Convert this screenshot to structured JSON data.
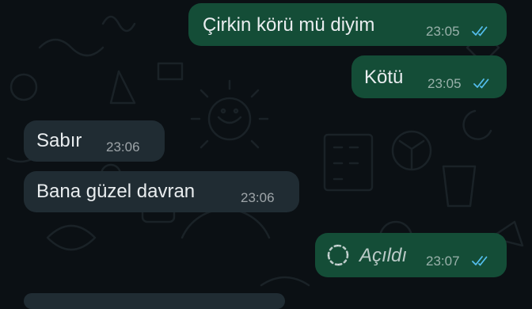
{
  "colors": {
    "background": "#0b1014",
    "outgoing_bubble": "#144d37",
    "incoming_bubble": "#202c33",
    "read_ticks": "#53bdeb",
    "text": "#e9edef"
  },
  "messages": [
    {
      "direction": "outgoing",
      "text": "Çirkin körü mü diyim",
      "time": "23:05",
      "status": "read"
    },
    {
      "direction": "outgoing",
      "text": "Kötü",
      "time": "23:05",
      "status": "read"
    },
    {
      "direction": "incoming",
      "text": "Sabır",
      "time": "23:06"
    },
    {
      "direction": "incoming",
      "text": "Bana güzel davran",
      "time": "23:06"
    },
    {
      "direction": "outgoing",
      "text": "Açıldı",
      "time": "23:07",
      "status": "read",
      "type": "view-once-opened",
      "icon": "view-once-opened-icon"
    }
  ]
}
